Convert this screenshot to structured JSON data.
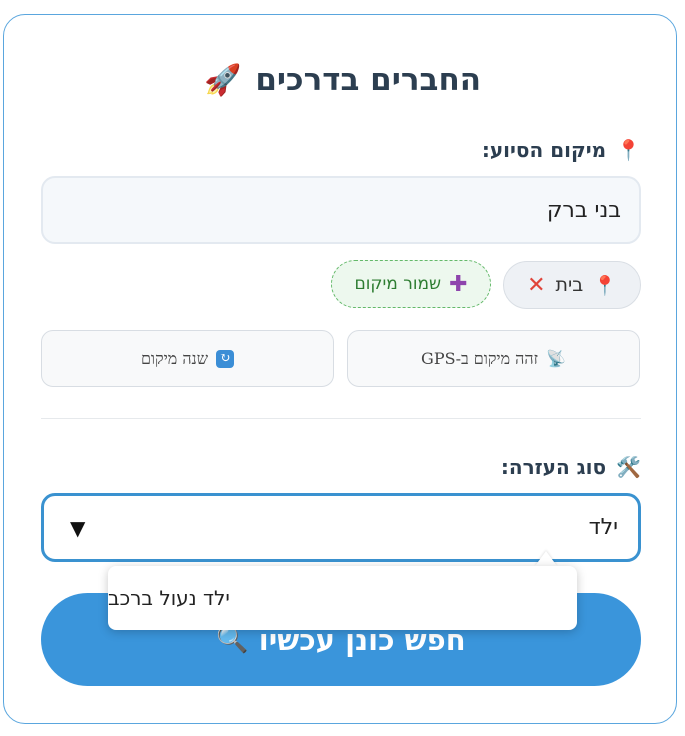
{
  "header": {
    "title": "החברים בדרכים",
    "icon": "rocket-icon"
  },
  "location": {
    "label": "מיקום הסיוע:",
    "label_icon": "pin-icon",
    "value": "בני ברק",
    "saved_chip": {
      "label": "בית",
      "remove_icon": "close-icon"
    },
    "save_chip_label": "שמור מיקום",
    "gps_button": "זהה מיקום ב-GPS",
    "change_button": "שנה מיקום"
  },
  "help_type": {
    "label": "סוג העזרה:",
    "label_icon": "tools-icon",
    "selected": "ילד",
    "options": [
      "ילד נעול ברכב"
    ]
  },
  "search_button": "חפש כונן עכשיו",
  "colors": {
    "accent": "#3a95db",
    "saved_chip_border": "#64b96a",
    "remove": "#e0443a"
  }
}
